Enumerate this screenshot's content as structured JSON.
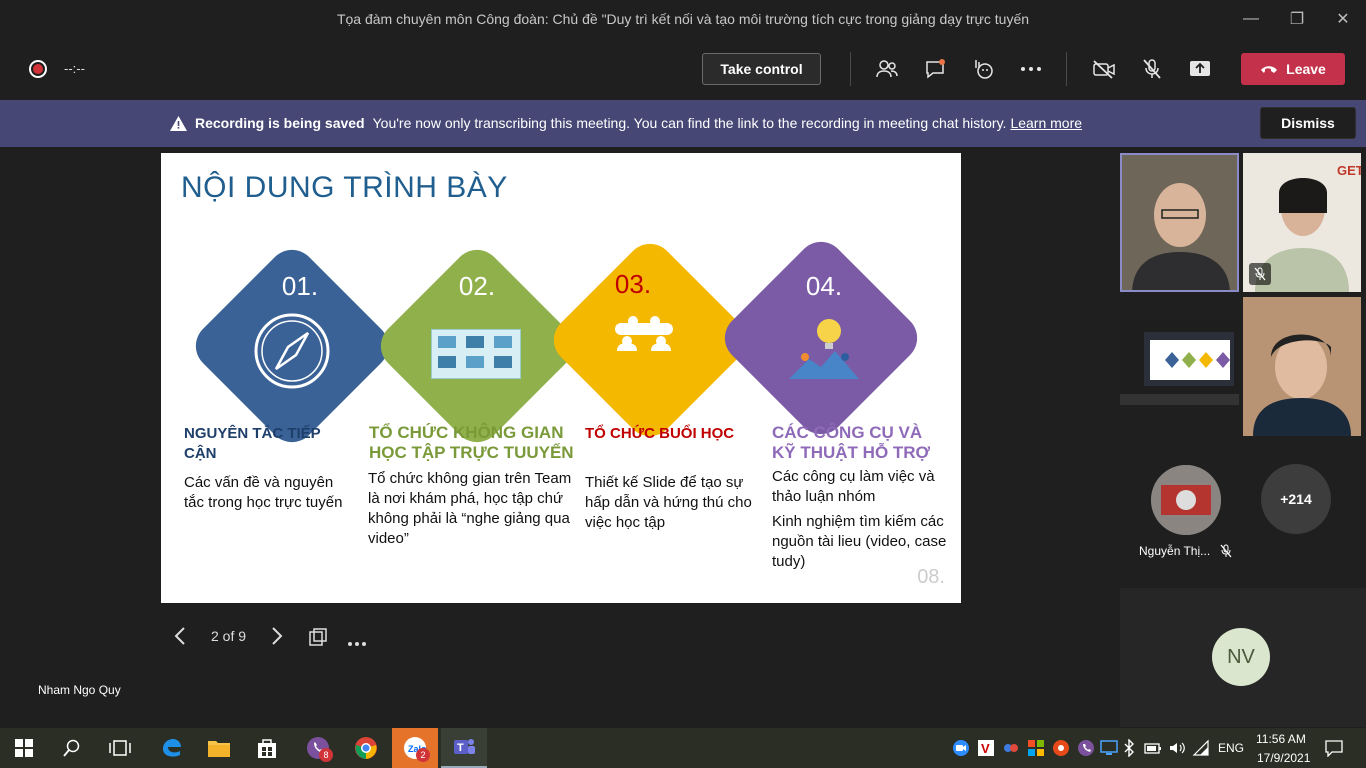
{
  "window": {
    "title": "Tọa đàm chuyên môn Công đoàn: Chủ đề \"Duy trì kết nối và tạo môi trường tích cực trong giảng dạy trực tuyến",
    "controls": [
      "—",
      "❐",
      "✕"
    ]
  },
  "toolbar": {
    "timer": "--:--",
    "take_control": "Take control",
    "leave": "Leave"
  },
  "banner": {
    "bold": "Recording is being saved",
    "message": "You're now only transcribing this meeting. You can find the link to the recording in meeting chat history.",
    "link": "Learn more",
    "dismiss": "Dismiss"
  },
  "slide": {
    "title": "NỘI DUNG TRÌNH BÀY",
    "page_number": "08.",
    "items": [
      {
        "num": "01.",
        "heading": "NGUYÊN TẮC TIẾP CẬN",
        "text": "Các vấn đề và nguyên tắc trong học trực tuyến",
        "color": "#3a6296"
      },
      {
        "num": "02.",
        "heading": "TỔ CHỨC KHÔNG GIAN HỌC TẬP TRỰC TUUYẾN",
        "text": "Tổ chức không gian trên Team là nơi khám phá, học tập chứ không phải là “nghe giảng qua video”",
        "color": "#8fb04a"
      },
      {
        "num": "03.",
        "heading": "TỔ CHỨC BUỔI HỌC",
        "text": "Thiết kế Slide để tạo sự hấp dẫn và hứng thú cho việc học tập",
        "color": "#f5b800"
      },
      {
        "num": "04.",
        "heading": "CÁC CÔNG CỤ VÀ KỸ THUẬT HỖ TRỢ",
        "text": "Các công cụ làm việc và thảo luận nhóm",
        "text2": "Kinh nghiệm tìm kiếm các nguồn tài lieu (video, case tudy)",
        "color": "#7b5ba6"
      }
    ]
  },
  "slide_nav": {
    "counter": "2 of 9"
  },
  "presenter": {
    "name": "Nham Ngo Quy"
  },
  "participants": {
    "named": "Nguyễn Thị...",
    "more": "+214",
    "initials": "NV"
  },
  "taskbar": {
    "viber_badge": "8",
    "zalo_badge": "2",
    "lang": "ENG",
    "time": "11:56 AM",
    "date": "17/9/2021"
  },
  "colors": {
    "accent": "#464775",
    "leave": "#c4314b",
    "slide_title": "#1f5e8e"
  }
}
